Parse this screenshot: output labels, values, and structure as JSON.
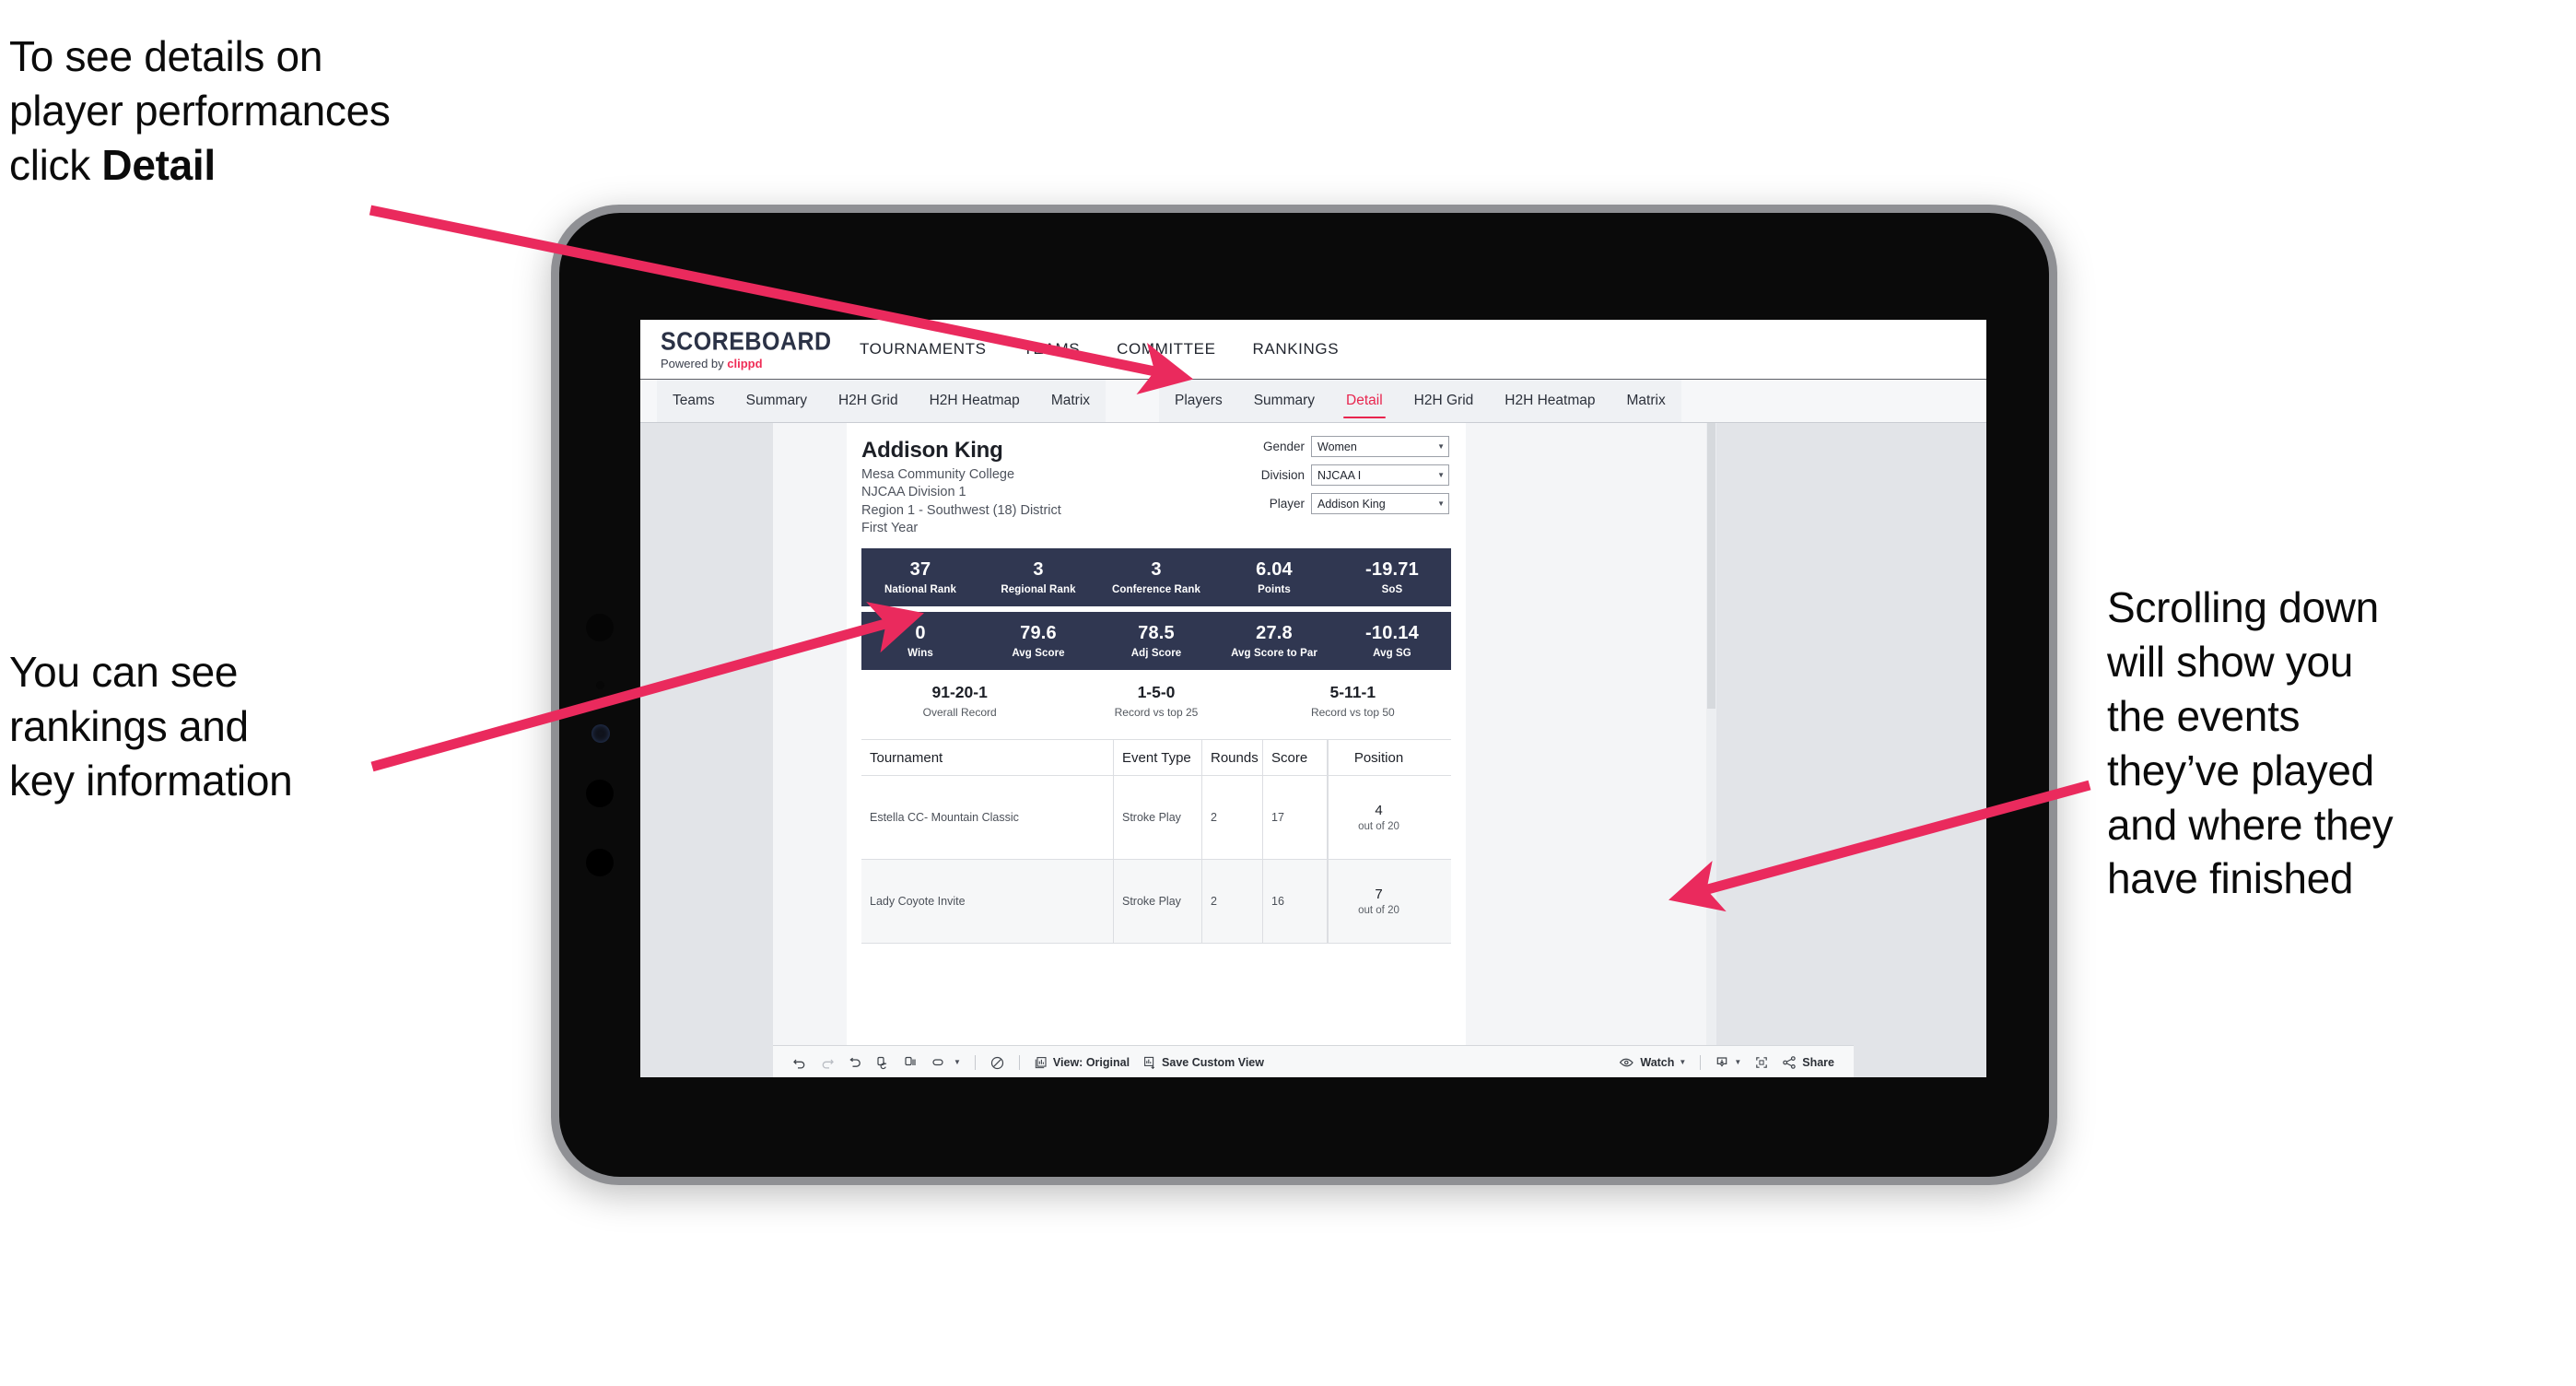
{
  "annotations": {
    "detail": "To see details on\nplayer performances\nclick ",
    "detail_bold": "Detail",
    "rankings": "You can see\nrankings and\nkey information",
    "scrolling": "Scrolling down\nwill show you\nthe events\nthey’ve played\nand where they\nhave finished",
    "arrow_color": "#ea2a5d"
  },
  "app": {
    "brand": {
      "title": "SCOREBOARD",
      "powered_prefix": "Powered by ",
      "powered_brand": "clippd"
    },
    "topnav": [
      {
        "label": "TOURNAMENTS"
      },
      {
        "label": "TEAMS"
      },
      {
        "label": "COMMITTEE"
      },
      {
        "label": "RANKINGS"
      }
    ],
    "subnav": {
      "group_teams": [
        {
          "label": "Teams",
          "active": false
        },
        {
          "label": "Summary",
          "active": false
        },
        {
          "label": "H2H Grid",
          "active": false
        },
        {
          "label": "H2H Heatmap",
          "active": false
        },
        {
          "label": "Matrix",
          "active": false
        }
      ],
      "group_players": [
        {
          "label": "Players",
          "active": false
        },
        {
          "label": "Summary",
          "active": false
        },
        {
          "label": "Detail",
          "active": true
        },
        {
          "label": "H2H Grid",
          "active": false
        },
        {
          "label": "H2H Heatmap",
          "active": false
        },
        {
          "label": "Matrix",
          "active": false
        }
      ]
    },
    "accent": "#e8254e",
    "band_color": "#303751"
  },
  "player": {
    "name": "Addison King",
    "college": "Mesa Community College",
    "division": "NJCAA Division 1",
    "region": "Region 1 - Southwest (18) District",
    "year": "First Year"
  },
  "filters": [
    {
      "label": "Gender",
      "value": "Women"
    },
    {
      "label": "Division",
      "value": "NJCAA I"
    },
    {
      "label": "Player",
      "value": "Addison King"
    }
  ],
  "stats_row1": [
    {
      "value": "37",
      "label": "National Rank"
    },
    {
      "value": "3",
      "label": "Regional Rank"
    },
    {
      "value": "3",
      "label": "Conference Rank"
    },
    {
      "value": "6.04",
      "label": "Points"
    },
    {
      "value": "-19.71",
      "label": "SoS"
    }
  ],
  "stats_row2": [
    {
      "value": "0",
      "label": "Wins"
    },
    {
      "value": "79.6",
      "label": "Avg Score"
    },
    {
      "value": "78.5",
      "label": "Adj Score"
    },
    {
      "value": "27.8",
      "label": "Avg Score to Par"
    },
    {
      "value": "-10.14",
      "label": "Avg SG"
    }
  ],
  "records": [
    {
      "value": "91-20-1",
      "label": "Overall Record"
    },
    {
      "value": "1-5-0",
      "label": "Record vs top 25"
    },
    {
      "value": "5-11-1",
      "label": "Record vs top 50"
    }
  ],
  "events_table": {
    "headers": {
      "tournament": "Tournament",
      "event_type": "Event Type",
      "rounds": "Rounds",
      "score": "Score",
      "position": "Position"
    },
    "rows": [
      {
        "tournament": "Estella CC- Mountain Classic",
        "event_type": "Stroke Play",
        "rounds": "2",
        "score": "17",
        "position": "4",
        "position_sub": "out of 20"
      },
      {
        "tournament": "Lady Coyote Invite",
        "event_type": "Stroke Play",
        "rounds": "2",
        "score": "16",
        "position": "7",
        "position_sub": "out of 20"
      }
    ]
  },
  "toolbar": {
    "view_label": "View: Original",
    "save_label": "Save Custom View",
    "watch_label": "Watch",
    "share_label": "Share"
  }
}
